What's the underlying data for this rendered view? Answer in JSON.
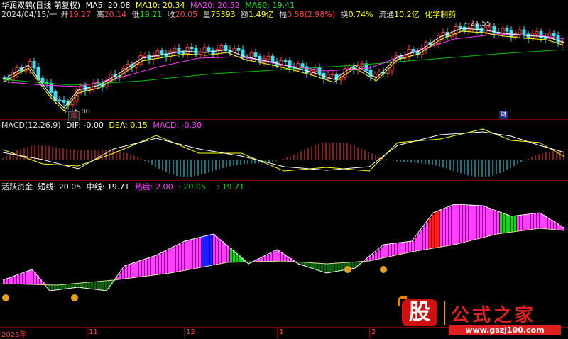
{
  "title": {
    "stock": "华润双鹤(日线 前复权)",
    "date": "2024/04/15/一",
    "open_label": "开",
    "open": "19.27",
    "high_label": "高",
    "high": "20.14",
    "low_label": "低",
    "low": "19.21",
    "close_label": "收",
    "close": "20.05",
    "vol_label": "量",
    "vol": "75393",
    "amt_label": "额",
    "amt": "1.49亿",
    "chg_label": "幅",
    "chg": "0.58(2.98%)",
    "turn_label": "换",
    "turn": "0.74%",
    "float_label": "流通",
    "float": "10.2亿",
    "industry": "化学制药"
  },
  "ma": {
    "ma5_label": "MA5:",
    "ma5": "20.08",
    "ma10_label": "MA10:",
    "ma10": "20.34",
    "ma20_label": "MA20:",
    "ma20": "20.52",
    "ma60_label": "MA60:",
    "ma60": "19.41"
  },
  "price_annotations": {
    "high_mark": "21.55",
    "low_mark": "15.80",
    "low_tag": "杀",
    "fin_tag": "财"
  },
  "macd": {
    "name": "MACD(12,26,9)",
    "dif_label": "DIF:",
    "dif": "-0.00",
    "dea_label": "DEA:",
    "dea": "0.15",
    "macd_label": "MACD:",
    "macd": "-0.30"
  },
  "active": {
    "name": "活跃资金",
    "short_label": "短线:",
    "short": "20.05",
    "mid_label": "中线:",
    "mid": "19.71",
    "heat_label": "热度:",
    "heat": "2.00",
    "v4_label": ":",
    "v4": "20.05",
    "v5_label": ":",
    "v5": "19.71"
  },
  "xaxis": {
    "labels": [
      "2023年",
      "11",
      "12",
      "1",
      "2"
    ]
  },
  "watermark": {
    "badge": "股",
    "name": "公式之家",
    "url": "www.gszj100.com"
  },
  "chart_data": [
    {
      "type": "candlestick",
      "title": "华润双鹤(日线 前复权)",
      "annotations": [
        "21.55",
        "15.80"
      ]
    },
    {
      "type": "bar",
      "title": "MACD(12,26,9)",
      "series": [
        {
          "name": "DIF",
          "values": [
            "-0.00"
          ]
        },
        {
          "name": "DEA",
          "values": [
            "0.15"
          ]
        },
        {
          "name": "MACD",
          "values": [
            "-0.30"
          ]
        }
      ]
    },
    {
      "type": "bar",
      "title": "活跃资金",
      "series": [
        {
          "name": "短线",
          "values": [
            "20.05"
          ]
        },
        {
          "name": "中线",
          "values": [
            "19.71"
          ]
        },
        {
          "name": "热度",
          "values": [
            "2.00"
          ]
        }
      ]
    }
  ],
  "colors": {
    "up": "#ff4040",
    "down": "#40e0f0",
    "ma5": "#ffffff",
    "ma10": "#ffff00",
    "ma20": "#ff40ff",
    "ma60": "#00c000",
    "magenta": "#ff40ff",
    "blue": "#2020ff",
    "red": "#ff2020",
    "green": "#20d020",
    "dkgreen": "#106010"
  }
}
